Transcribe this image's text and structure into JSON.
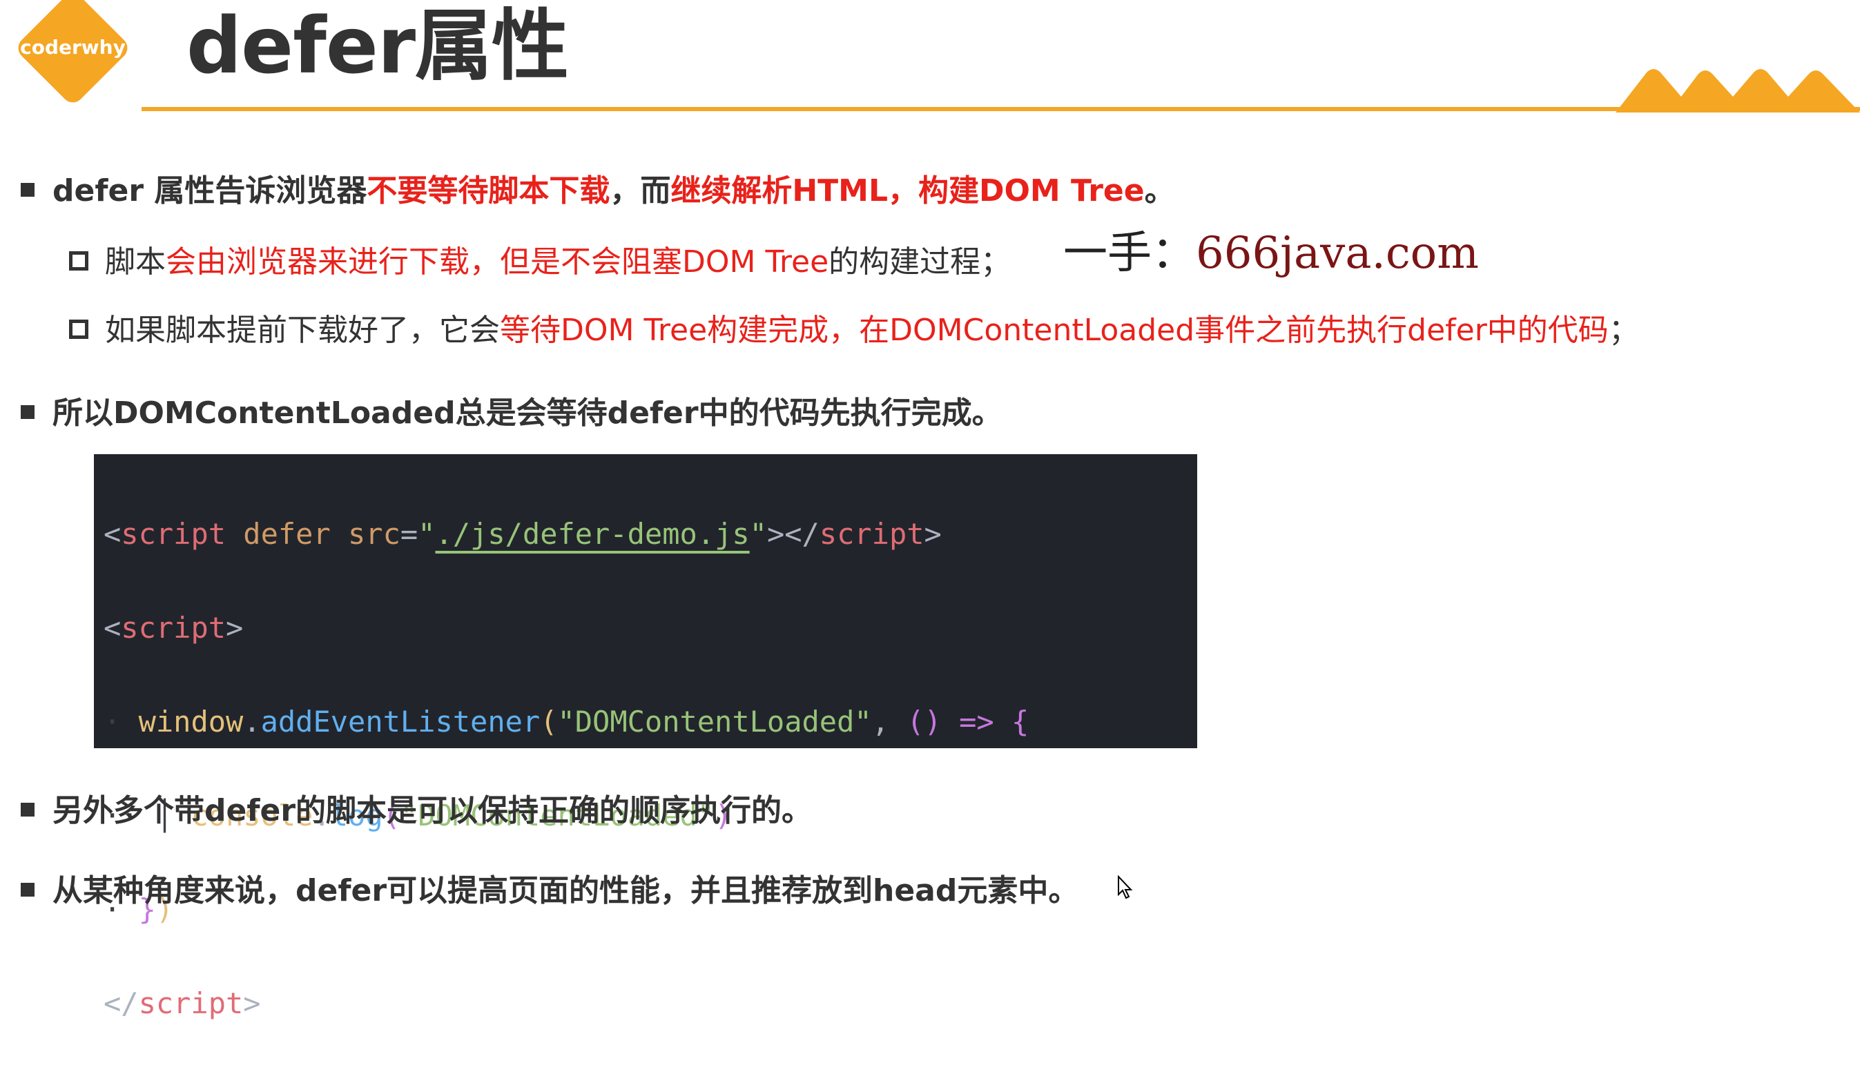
{
  "logo": {
    "text": "coderwhy"
  },
  "title": "defer属性",
  "bullets": {
    "b1": {
      "part1": "defer 属性告诉浏览器",
      "red1": "不要等待脚本下载",
      "part2": "，而",
      "red2": "继续解析HTML，构建DOM Tree",
      "part3": "。"
    },
    "sub1": {
      "part1": "脚本",
      "red1": "会由浏览器来进行下载，但是不会阻塞DOM Tree",
      "part2": "的构建过程；"
    },
    "sub2": {
      "part1": "如果脚本提前下载好了，它会",
      "red1": "等待DOM Tree构建完成，在DOMContentLoaded事件之前先执行defer中的代码",
      "part2": "；"
    },
    "b2": "所以DOMContentLoaded总是会等待defer中的代码先执行完成。",
    "b3": "另外多个带defer的脚本是可以保持正确的顺序执行的。",
    "b4": "从某种角度来说，defer可以提高页面的性能，并且推荐放到head元素中。"
  },
  "watermark": {
    "prefix": "一手：",
    "site": "666java.com"
  },
  "code": {
    "l1": {
      "open": "<",
      "tag": "script",
      "attr1": " defer",
      "attr2": " src",
      "eq": "=",
      "q1": "\"",
      "src": "./js/defer-demo.js",
      "q2": "\"",
      "close": "></",
      "tag2": "script",
      "end": ">"
    },
    "l2": {
      "open": "<",
      "tag": "script",
      "end": ">"
    },
    "l3": {
      "obj": "window",
      "dot": ".",
      "fn": "addEventListener",
      "p1": "(",
      "str": "\"DOMContentLoaded\"",
      "comma": ", ",
      "args": "()",
      "arrow": " => ",
      "brace": "{"
    },
    "l4": {
      "obj": "console",
      "dot": ".",
      "fn": "log",
      "p1": "(",
      "str": "\"DOMContentLoaded\"",
      "p2": ")"
    },
    "l5": {
      "brace": "}",
      "paren": ")"
    },
    "l6": {
      "open": "</",
      "tag": "script",
      "end": ">"
    }
  },
  "colors": {
    "accent": "#f5a623",
    "highlight": "#e8221b",
    "code_bg": "#21252b"
  }
}
